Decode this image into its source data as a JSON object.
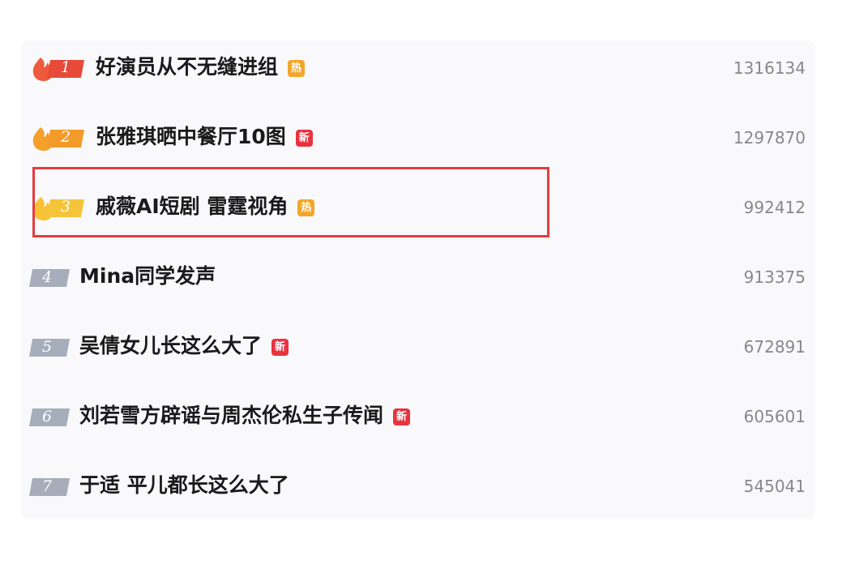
{
  "colors": {
    "flame_rank1": "#f05a3c",
    "flame_rank2": "#f5a028",
    "flame_rank3": "#f7c233",
    "plain_rank": "#a6aebb",
    "hot_badge": "#f3a52b",
    "new_badge": "#e8333f",
    "highlight_border": "#e53b3f"
  },
  "hot_list": [
    {
      "rank": "1",
      "title": "好演员从不无缝进组",
      "badge": "热",
      "badge_type": "hot",
      "count": "1316134",
      "rank_style": "flame-red"
    },
    {
      "rank": "2",
      "title": "张雅琪晒中餐厅10图",
      "badge": "新",
      "badge_type": "new",
      "count": "1297870",
      "rank_style": "flame-orange"
    },
    {
      "rank": "3",
      "title": "戚薇AI短剧 雷霆视角",
      "badge": "热",
      "badge_type": "hot",
      "count": "992412",
      "rank_style": "flame-yellow"
    },
    {
      "rank": "4",
      "title": "Mina同学发声",
      "badge": "",
      "badge_type": "none",
      "count": "913375",
      "rank_style": "plain"
    },
    {
      "rank": "5",
      "title": "吴倩女儿长这么大了",
      "badge": "新",
      "badge_type": "new",
      "count": "672891",
      "rank_style": "plain"
    },
    {
      "rank": "6",
      "title": "刘若雪方辟谣与周杰伦私生子传闻",
      "badge": "新",
      "badge_type": "new",
      "count": "605601",
      "rank_style": "plain"
    },
    {
      "rank": "7",
      "title": "于适 平儿都长这么大了",
      "badge": "",
      "badge_type": "none",
      "count": "545041",
      "rank_style": "plain"
    }
  ]
}
